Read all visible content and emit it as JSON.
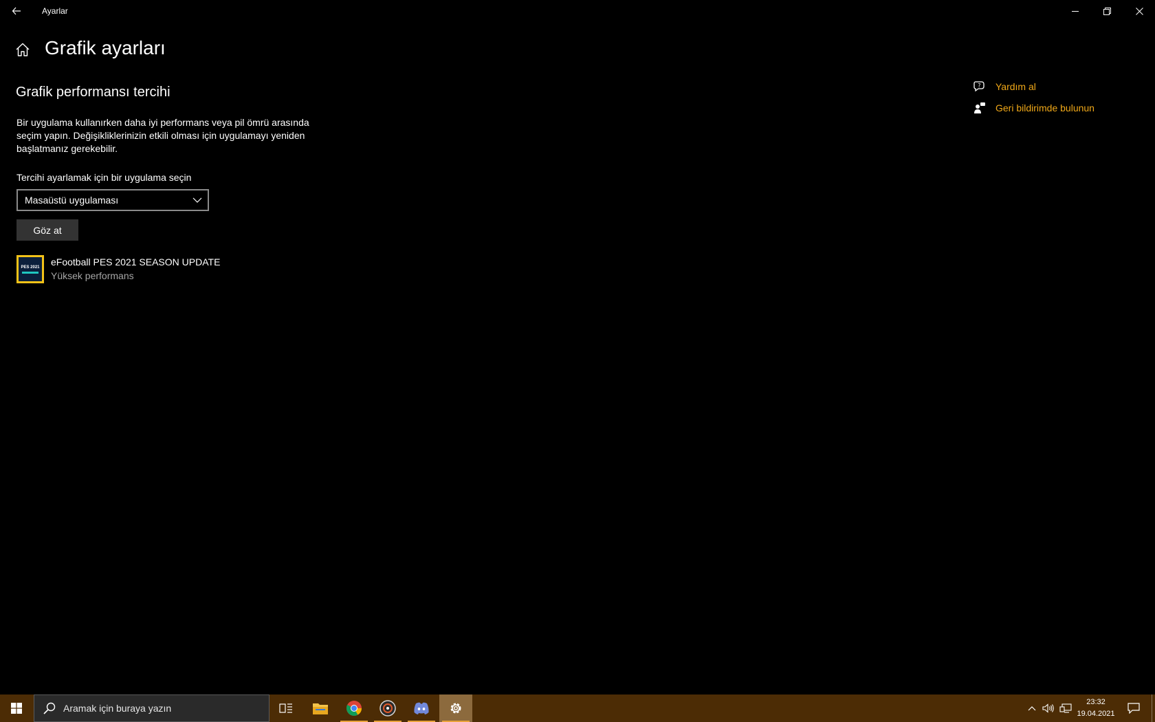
{
  "window": {
    "title": "Ayarlar"
  },
  "page": {
    "title": "Grafik ayarları"
  },
  "section": {
    "title": "Grafik performansı tercihi",
    "description": "Bir uygulama kullanırken daha iyi performans veya pil ömrü arasında seçim yapın. Değişikliklerinizin etkili olması için uygulamayı yeniden başlatmanız gerekebilir."
  },
  "selector": {
    "label": "Tercihi ayarlamak için bir uygulama seçin",
    "value": "Masaüstü uygulaması",
    "browse_label": "Göz at"
  },
  "apps": [
    {
      "name": "eFootball PES 2021 SEASON UPDATE",
      "performance": "Yüksek performans",
      "icon_text": "PES 2021"
    }
  ],
  "help_links": {
    "get_help": "Yardım al",
    "feedback": "Geri bildirimde bulunun"
  },
  "taskbar": {
    "search_placeholder": "Aramak için buraya yazın",
    "time": "23:32",
    "date": "19.04.2021",
    "colors": {
      "taskbar_bg": "#4c2c05",
      "accent_link": "#f0a818"
    }
  }
}
